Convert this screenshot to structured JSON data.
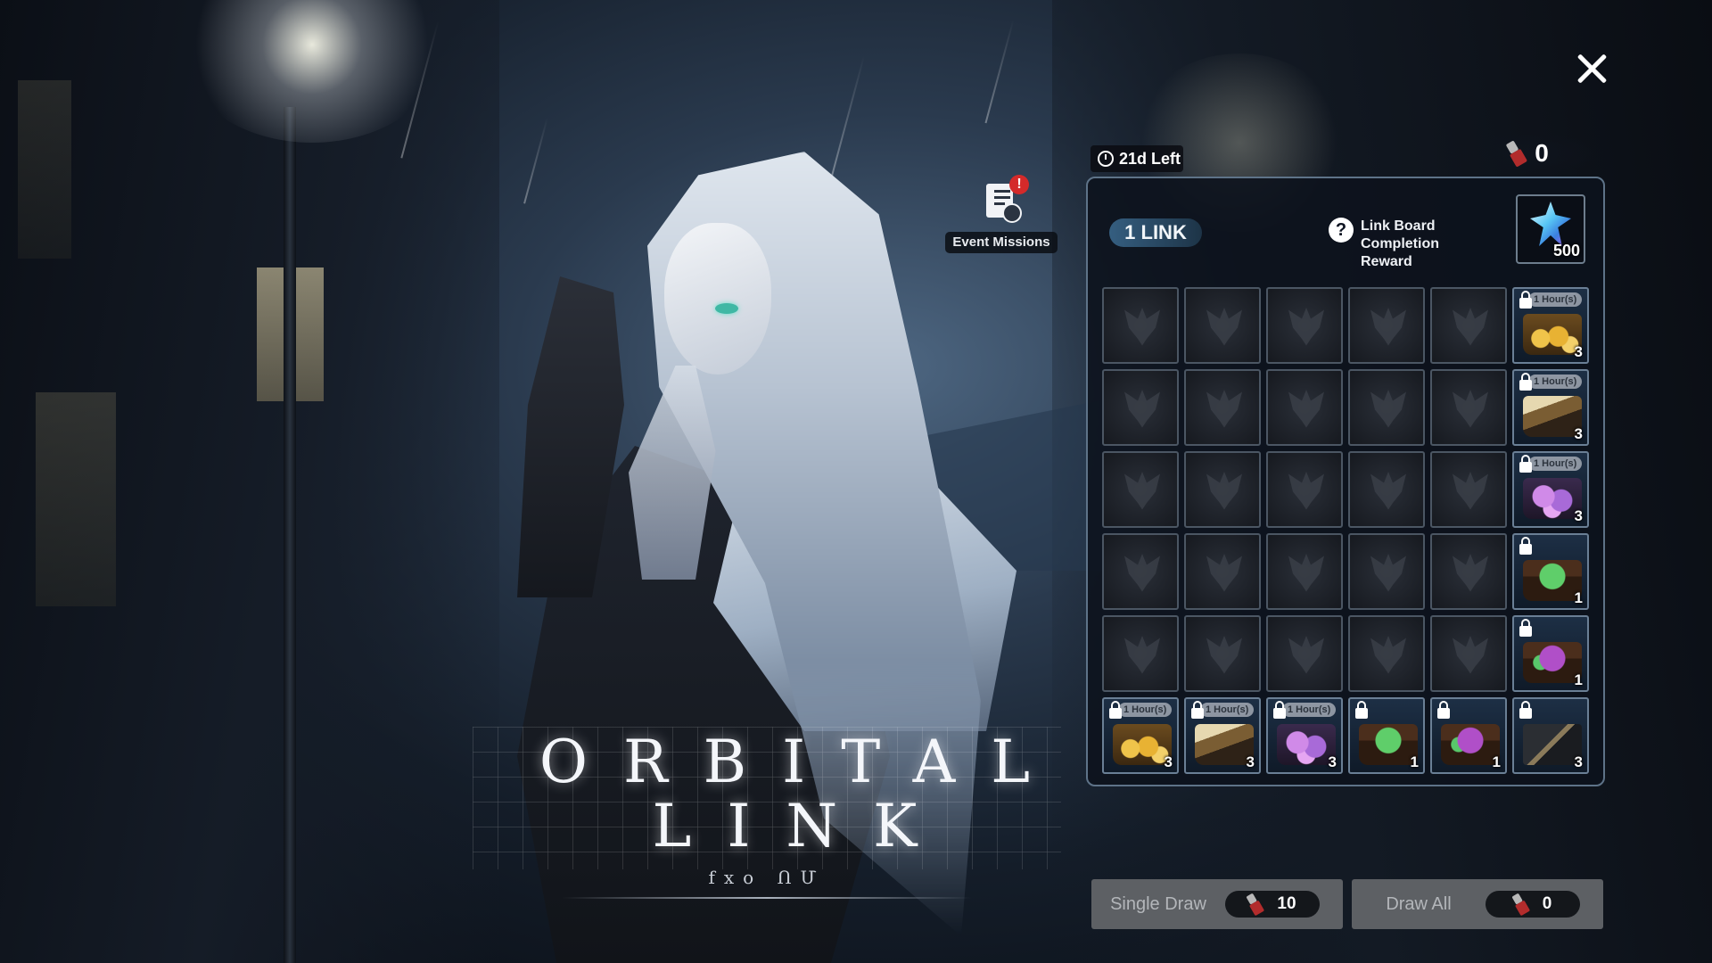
{
  "logo": {
    "line1": "ORBITAL",
    "line2": "LINK",
    "subtitle": "fxo ՈՄ"
  },
  "event_missions": {
    "label": "Event Missions",
    "alert": "!"
  },
  "timer": {
    "text": "21d Left"
  },
  "tokens": {
    "count": "0",
    "icon": "link-token-icon"
  },
  "board": {
    "link_badge": "1 LINK",
    "completion_label": "Link Board Completion Reward",
    "help_icon": "?",
    "reward": {
      "icon": "crystal-icon",
      "quantity": "500"
    },
    "hours_tag": "1 Hour(s)",
    "rows": [
      [
        {
          "type": "empty"
        },
        {
          "type": "empty"
        },
        {
          "type": "empty"
        },
        {
          "type": "empty"
        },
        {
          "type": "empty"
        },
        {
          "type": "reward",
          "art": "gold",
          "count": "3",
          "hours": true
        }
      ],
      [
        {
          "type": "empty"
        },
        {
          "type": "empty"
        },
        {
          "type": "empty"
        },
        {
          "type": "empty"
        },
        {
          "type": "empty"
        },
        {
          "type": "reward",
          "art": "scroll",
          "count": "3",
          "hours": true
        }
      ],
      [
        {
          "type": "empty"
        },
        {
          "type": "empty"
        },
        {
          "type": "empty"
        },
        {
          "type": "empty"
        },
        {
          "type": "empty"
        },
        {
          "type": "reward",
          "art": "flower",
          "count": "3",
          "hours": true
        }
      ],
      [
        {
          "type": "empty"
        },
        {
          "type": "empty"
        },
        {
          "type": "empty"
        },
        {
          "type": "empty"
        },
        {
          "type": "empty"
        },
        {
          "type": "reward",
          "art": "chest-green",
          "count": "1",
          "hours": false
        }
      ],
      [
        {
          "type": "empty"
        },
        {
          "type": "empty"
        },
        {
          "type": "empty"
        },
        {
          "type": "empty"
        },
        {
          "type": "empty"
        },
        {
          "type": "reward",
          "art": "chest-purple",
          "count": "1",
          "hours": false
        }
      ],
      [
        {
          "type": "reward",
          "art": "gold",
          "count": "3",
          "hours": true
        },
        {
          "type": "reward",
          "art": "scroll",
          "count": "3",
          "hours": true
        },
        {
          "type": "reward",
          "art": "flower",
          "count": "3",
          "hours": true
        },
        {
          "type": "reward",
          "art": "chest-green",
          "count": "1",
          "hours": false
        },
        {
          "type": "reward",
          "art": "chest-purple",
          "count": "1",
          "hours": false
        },
        {
          "type": "reward",
          "art": "dark",
          "count": "3",
          "hours": false
        }
      ]
    ]
  },
  "buttons": {
    "single_draw": {
      "label": "Single Draw",
      "cost": "10"
    },
    "draw_all": {
      "label": "Draw All",
      "cost": "0"
    }
  },
  "colors": {
    "panel_border": "#5e7388",
    "link_badge": "#355e80",
    "alert": "#d42a2a",
    "button": "#5d6064"
  }
}
